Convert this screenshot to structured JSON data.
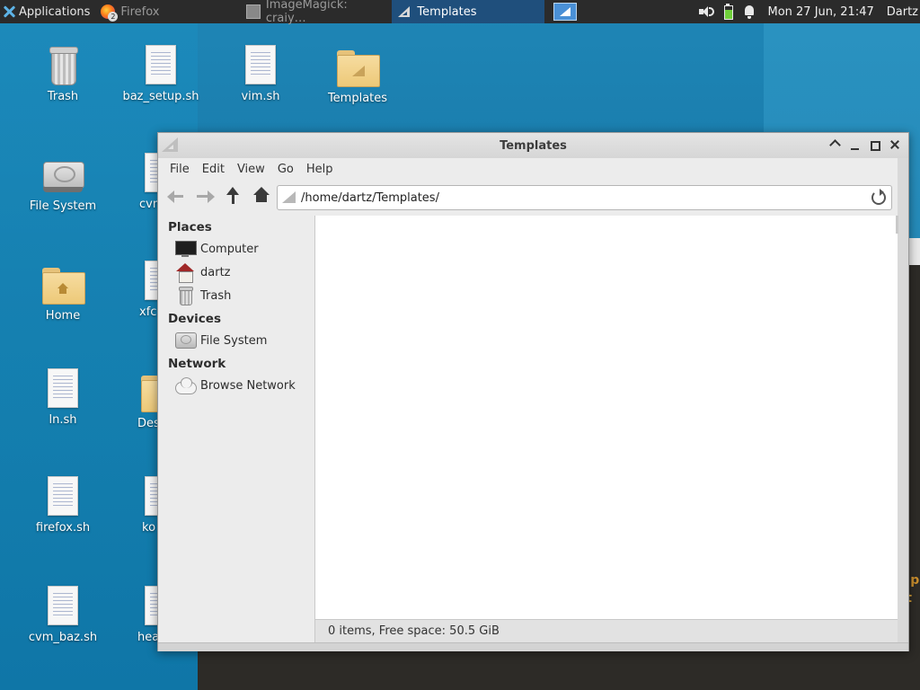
{
  "panel": {
    "applications_label": "Applications",
    "tasks": [
      {
        "label": "Firefox",
        "badge": "2",
        "icon": "firefox-icon"
      },
      {
        "label": "ImageMagick: craiy…",
        "icon": "imagemagick-icon"
      },
      {
        "label": "Templates",
        "icon": "templates-icon",
        "active": true
      }
    ],
    "clock": "Mon 27 Jun, 21:47",
    "user": "Dartz"
  },
  "desktop": {
    "icons": [
      {
        "label": "Trash",
        "icon": "trash-icon"
      },
      {
        "label": "baz_setup.sh",
        "icon": "text-document-icon"
      },
      {
        "label": "vim.sh",
        "icon": "text-document-icon"
      },
      {
        "label": "Templates",
        "icon": "templates-folder-icon"
      },
      {
        "label": "File System",
        "icon": "drive-icon"
      },
      {
        "label": "cvm",
        "icon": "text-document-icon"
      },
      {
        "label": "Home",
        "icon": "home-folder-icon"
      },
      {
        "label": "xfc",
        "icon": "text-document-icon"
      },
      {
        "label": "ln.sh",
        "icon": "text-document-icon"
      },
      {
        "label": "Des",
        "icon": "folder-icon"
      },
      {
        "label": "firefox.sh",
        "icon": "text-document-icon"
      },
      {
        "label": "ko",
        "icon": "text-document-icon"
      },
      {
        "label": "cvm_baz.sh",
        "icon": "text-document-icon"
      },
      {
        "label": "head.sh",
        "icon": "text-document-icon"
      }
    ],
    "bg_fragments": [
      "er p",
      "lat"
    ]
  },
  "window": {
    "title": "Templates",
    "menu": [
      "File",
      "Edit",
      "View",
      "Go",
      "Help"
    ],
    "location": "/home/dartz/Templates/",
    "sidebar": {
      "places_header": "Places",
      "places": [
        {
          "label": "Computer",
          "icon": "computer-icon"
        },
        {
          "label": "dartz",
          "icon": "home-icon"
        },
        {
          "label": "Trash",
          "icon": "trash-icon"
        }
      ],
      "devices_header": "Devices",
      "devices": [
        {
          "label": "File System",
          "icon": "drive-icon"
        }
      ],
      "network_header": "Network",
      "network": [
        {
          "label": "Browse Network",
          "icon": "network-cloud-icon"
        }
      ]
    },
    "status": "0 items, Free space: 50.5 GiB"
  },
  "colors": {
    "panel_bg": "#2b2b2b",
    "active_task": "#1f4f7c",
    "desktop_blue": "#1677a7"
  }
}
